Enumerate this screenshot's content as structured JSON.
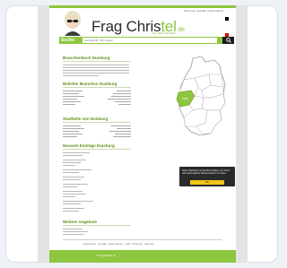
{
  "header": {
    "toplinks": "Werbung | Kontakt | Datenschutz",
    "flags": [
      "#000000",
      "#dd0000",
      "#ffce00"
    ],
    "logo_main": "Frag Chris",
    "logo_accent": "tel",
    "logo_dot": ".de",
    "tagline": "Dein Branchenbuch"
  },
  "search": {
    "label": "Suche",
    "placeholder": "Suchbegriff, z.B. Friseur",
    "button_icon": "search-icon"
  },
  "sections": {
    "intro_title": "Branchenbuch Duisburg",
    "popular_title": "Beliebte Branchen Duisburg",
    "districts_title": "Stadtteile von Duisburg",
    "new_title": "Neueste Einträge Duisburg",
    "partner_title": "Weitere Angebote"
  },
  "cookie": {
    "text": "Diese Webseite verwendet Cookies, um Ihnen das bestmögliche Nutzererlebnis zu bieten.",
    "button": "Ok"
  },
  "footer": {
    "links": "Impressum · Kontakt · Datenschutz · AGB · Werbung · Sitemap",
    "copyright": "© FragChristel.de"
  },
  "map": {
    "highlight_color": "#8dc63f"
  }
}
